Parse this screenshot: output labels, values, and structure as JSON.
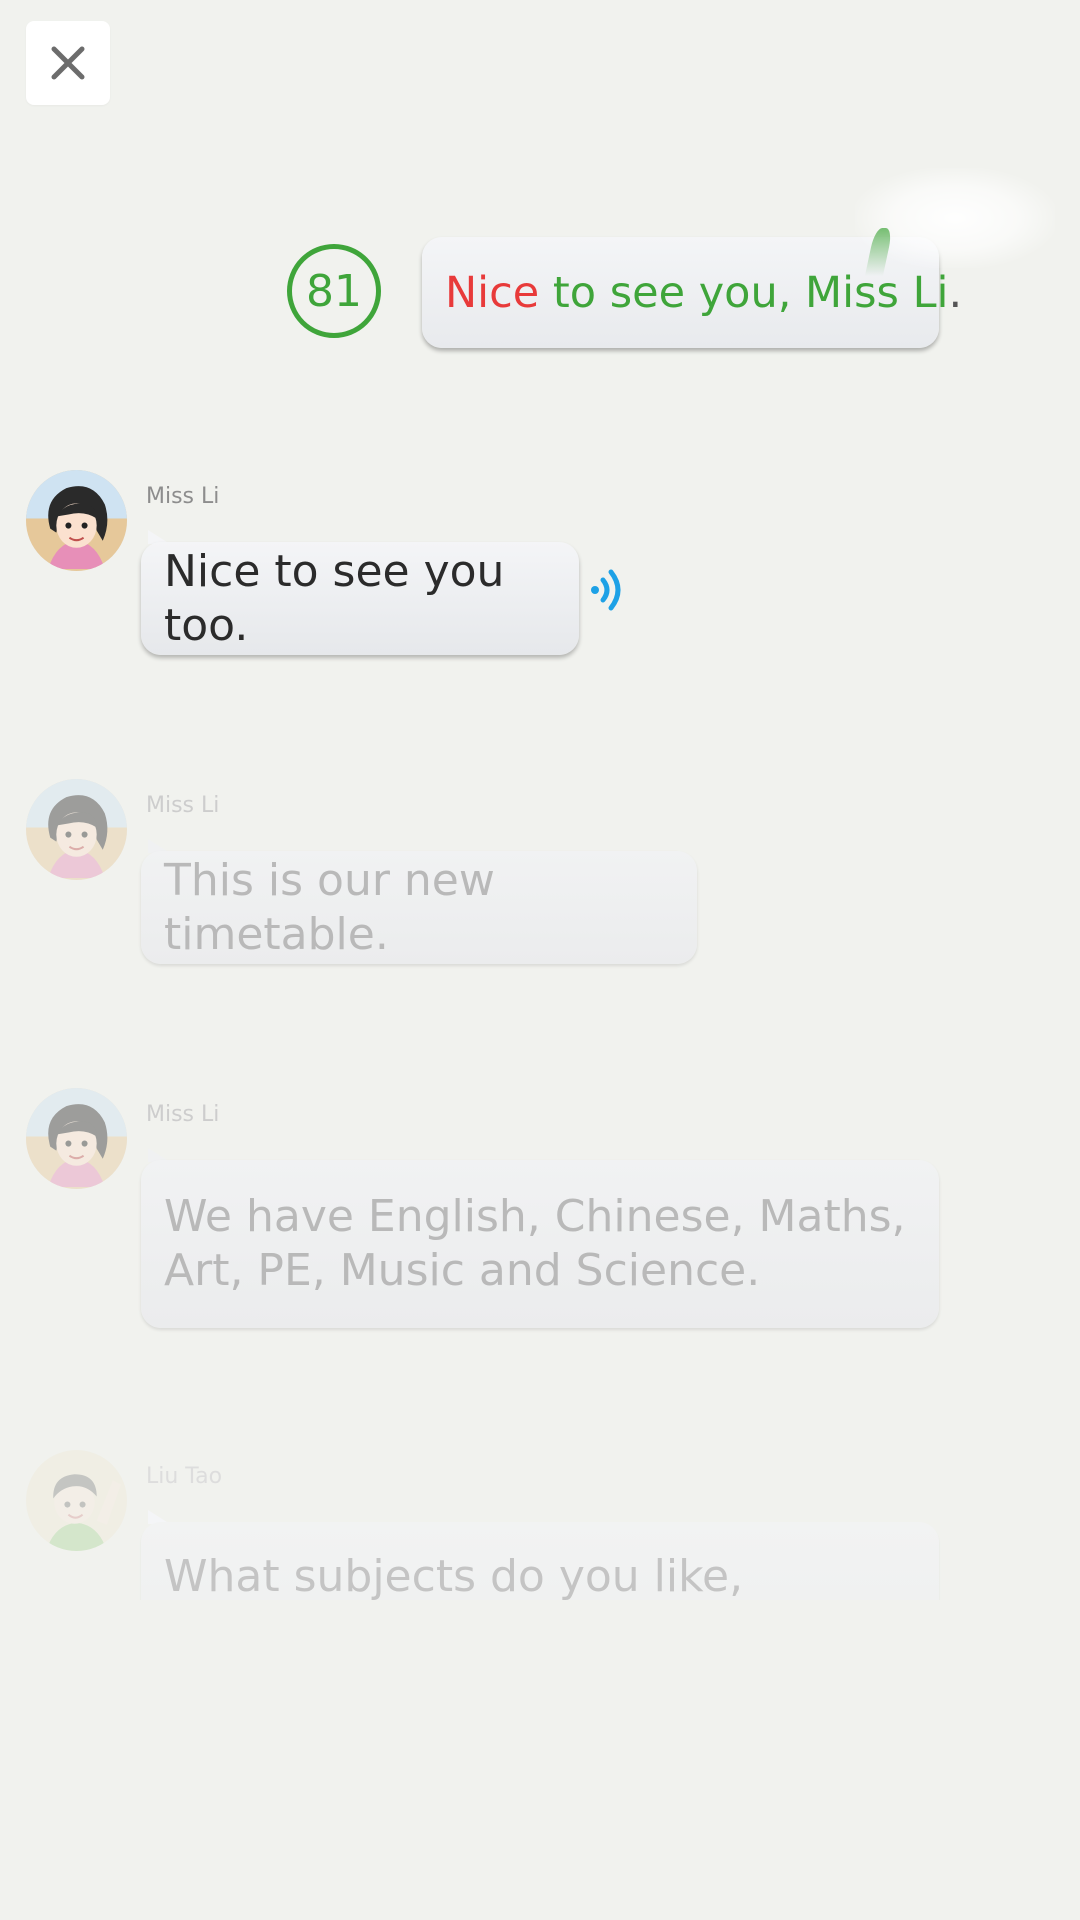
{
  "close_button": {
    "icon": "close-icon"
  },
  "score": {
    "value": "81",
    "color": "#3fa53a"
  },
  "learner_sentence": {
    "words": [
      {
        "text": "Nice",
        "status": "incorrect",
        "color": "#e83a3a"
      },
      {
        "text": " to see you, Miss Li",
        "status": "correct",
        "color": "#3fa53a"
      },
      {
        "text": ".",
        "status": "punctuation",
        "color": "#555555"
      }
    ]
  },
  "messages": [
    {
      "speaker": "Miss Li",
      "text": "Nice to see you too.",
      "state": "active",
      "audio_icon": "speaker-wave-icon",
      "audio_color": "#1da1e6"
    },
    {
      "speaker": "Miss Li",
      "text": "This is our new timetable.",
      "state": "upcoming"
    },
    {
      "speaker": "Miss Li",
      "line1": "We have English, Chinese, Maths,",
      "line2": "Art, PE, Music and Science.",
      "state": "upcoming"
    },
    {
      "speaker": "Liu Tao",
      "text": "What subjects do you like,",
      "state": "upcoming"
    }
  ]
}
